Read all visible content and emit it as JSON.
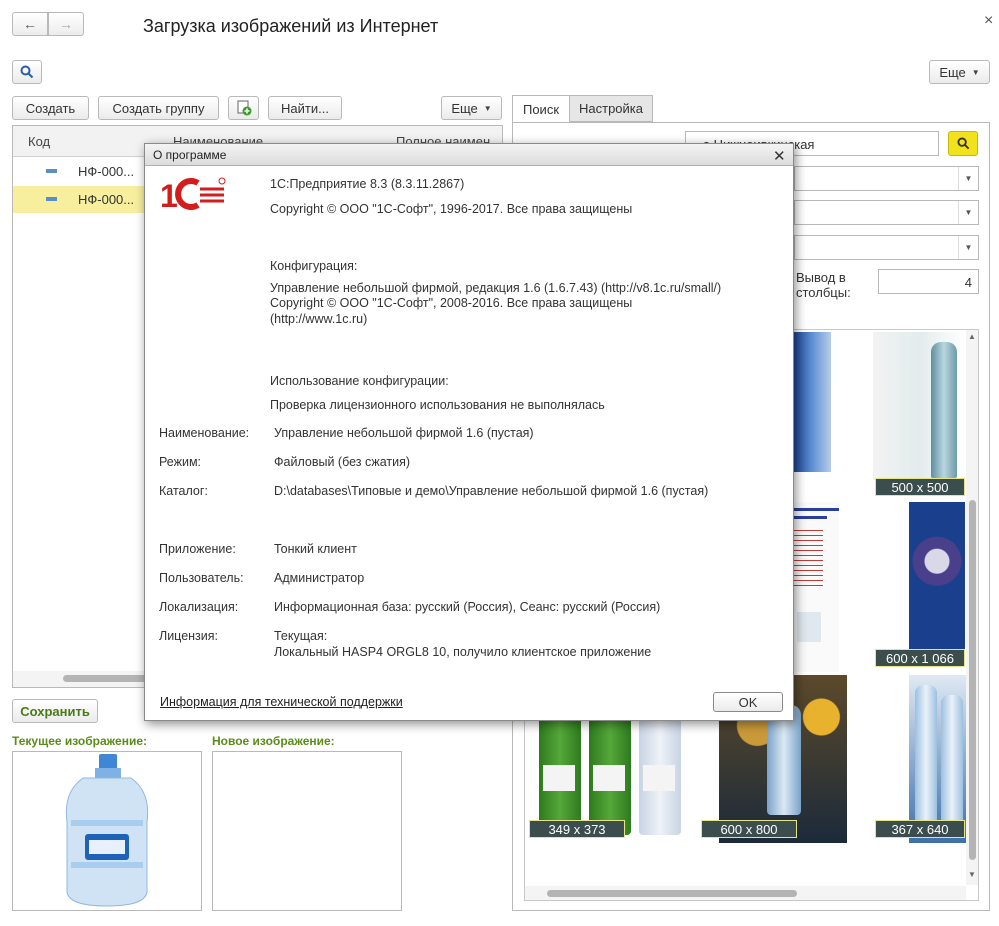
{
  "window": {
    "title": "Загрузка изображений из Интернет",
    "close_glyph": "×",
    "more_label": "Еще"
  },
  "toolbar": {
    "create": "Создать",
    "create_group": "Создать группу",
    "find": "Найти...",
    "more": "Еще"
  },
  "table": {
    "columns": [
      "Код",
      "Наименование",
      "Полное наимен"
    ],
    "rows": [
      {
        "code": "НФ-000..."
      },
      {
        "code": "НФ-000..."
      }
    ]
  },
  "tabs": {
    "search": "Поиск",
    "settings": "Настройка"
  },
  "search": {
    "query": "...а Нижнеивкинская",
    "columns_label_1": "Вывод в",
    "columns_label_2": "столбцы:",
    "columns_value": "4"
  },
  "images": [
    {
      "size": "500 x 500"
    },
    {
      "size": "600 x 1 066"
    },
    {
      "size": "349 x 373"
    },
    {
      "size": "600 x 800"
    },
    {
      "size": "367 x 640"
    }
  ],
  "bottom": {
    "save": "Сохранить",
    "current_image": "Текущее изображение:",
    "new_image": "Новое изображение:"
  },
  "dialog": {
    "title": "О программе",
    "platform": "1С:Предприятие 8.3 (8.3.11.2867)",
    "copyright": "Copyright © ООО \"1С-Софт\", 1996-2017. Все права защищены",
    "config_header": "Конфигурация:",
    "config_line1": "Управление небольшой фирмой, редакция 1.6 (1.6.7.43) (http://v8.1c.ru/small/)",
    "config_line2": "Copyright © ООО \"1С-Софт\", 2008-2016. Все права защищены",
    "config_line3": "(http://www.1c.ru)",
    "usage_header": "Использование конфигурации:",
    "usage_value": "Проверка лицензионного использования не выполнялась",
    "rows": [
      {
        "label": "Наименование:",
        "value": "Управление небольшой фирмой 1.6 (пустая)"
      },
      {
        "label": "Режим:",
        "value": "Файловый (без сжатия)"
      },
      {
        "label": "Каталог:",
        "value": "D:\\databases\\Типовые и демо\\Управление небольшой фирмой 1.6 (пустая)"
      },
      {
        "label": "Приложение:",
        "value": "Тонкий клиент"
      },
      {
        "label": "Пользователь:",
        "value": "Администратор"
      },
      {
        "label": "Локализация:",
        "value": "Информационная база: русский (Россия), Сеанс: русский (Россия)"
      }
    ],
    "license_label": "Лицензия:",
    "license_line1": "Текущая:",
    "license_line2": "Локальный HASP4 ORGL8 10, получило клиентское приложение",
    "support_link": "Информация для технической поддержки",
    "ok": "OK"
  },
  "colors": {
    "selection": "#f7ef9e",
    "accent_green": "#5b8c1a",
    "search_button": "#f2e21b",
    "logo_red": "#d31d1d"
  }
}
